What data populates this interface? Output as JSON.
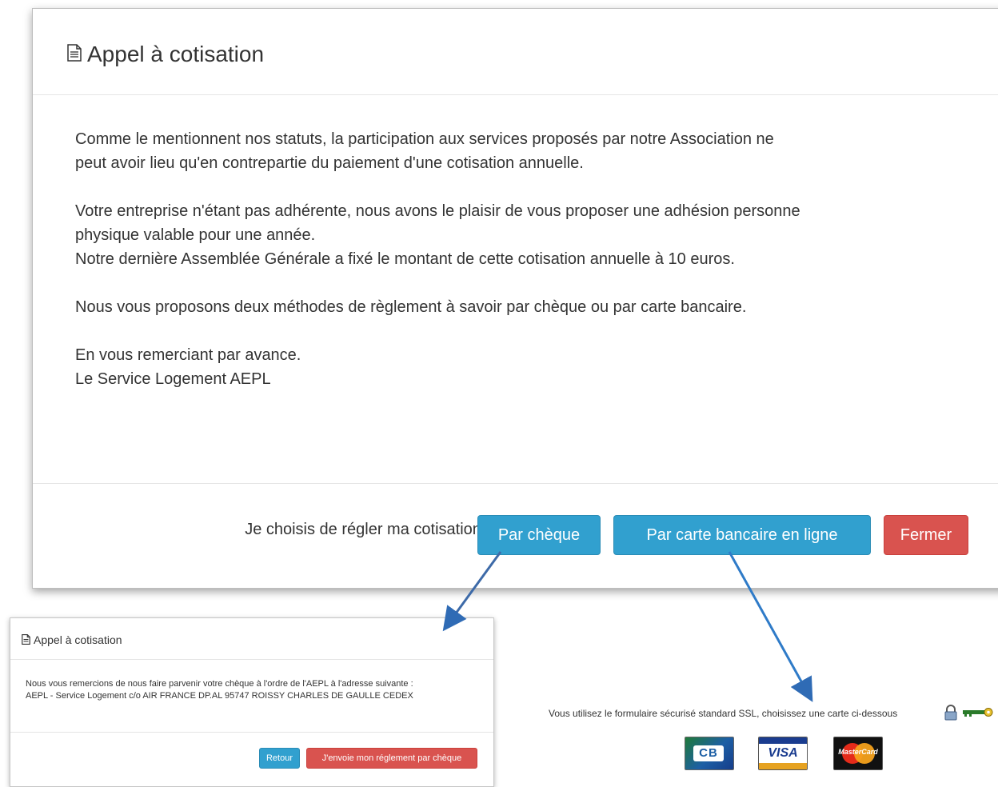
{
  "main_modal": {
    "title": "Appel à cotisation",
    "paragraphs": [
      [
        "Comme le mentionnent nos statuts, la participation aux services proposés par notre Association ne",
        "peut avoir lieu qu'en contrepartie du paiement d'une cotisation annuelle."
      ],
      [
        "Votre entreprise n'étant pas adhérente, nous avons le plaisir de vous proposer une adhésion personne",
        "physique valable pour une année.",
        "Notre dernière Assemblée Générale a fixé le montant de cette cotisation annuelle à 10 euros."
      ],
      [
        "Nous vous proposons deux méthodes de règlement à savoir par chèque ou par carte bancaire."
      ],
      [
        "En vous remerciant par avance.",
        "Le Service Logement AEPL"
      ]
    ],
    "footer_label": "Je choisis de régler ma cotisation :",
    "buttons": {
      "cheque": "Par chèque",
      "carte": "Par carte bancaire en ligne",
      "fermer": "Fermer"
    }
  },
  "cheque_modal": {
    "title": "Appel à cotisation",
    "body_lines": [
      "Nous vous remercions de nous faire parvenir votre chèque à l'ordre de l'AEPL à l'adresse suivante :",
      "AEPL - Service Logement c/o AIR FRANCE DP.AL 95747 ROISSY CHARLES DE GAULLE CEDEX"
    ],
    "buttons": {
      "retour": "Retour",
      "envoie": "J'envoie mon réglement par chèque"
    }
  },
  "payment": {
    "ssl_text": "Vous utilisez le formulaire sécurisé standard SSL, choisissez une carte ci-dessous",
    "cards": [
      {
        "name": "cb-card",
        "label": "CB"
      },
      {
        "name": "visa-card",
        "label": "VISA"
      },
      {
        "name": "mastercard-card",
        "label": "MasterCard"
      }
    ]
  },
  "colors": {
    "info": "#31a0cf",
    "danger": "#d9534f",
    "arrow": "#2f6bb5"
  }
}
